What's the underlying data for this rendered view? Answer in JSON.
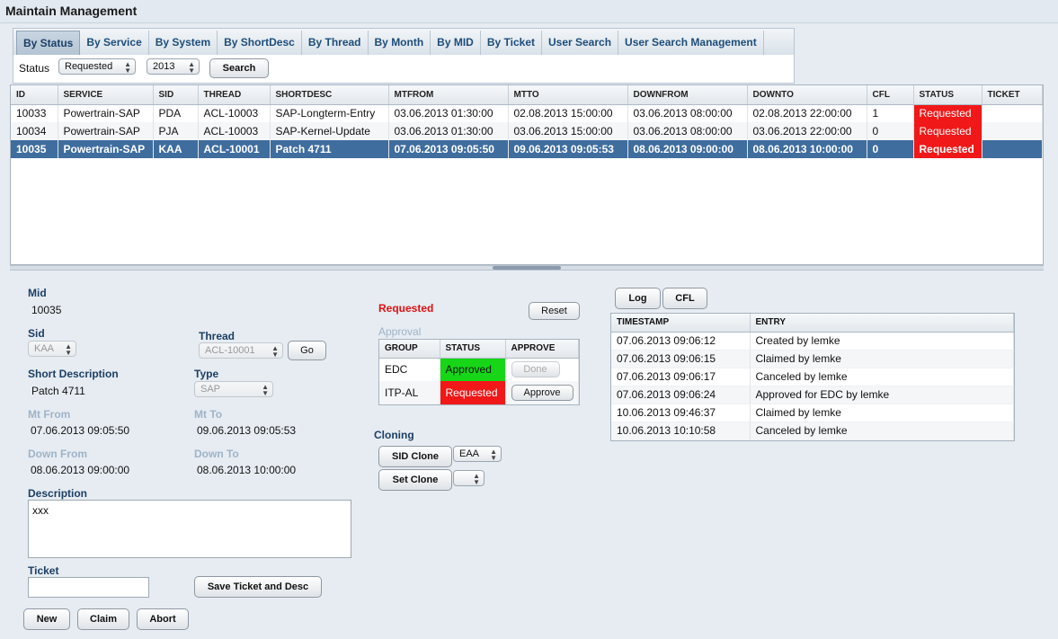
{
  "app": {
    "title": "Maintain Management"
  },
  "tabs": [
    "By Status",
    "By Service",
    "By System",
    "By ShortDesc",
    "By Thread",
    "By Month",
    "By MID",
    "By Ticket",
    "User Search",
    "User Search Management"
  ],
  "filter": {
    "status_label": "Status",
    "status_value": "Requested",
    "year_value": "2013",
    "search_label": "Search"
  },
  "grid": {
    "columns": [
      "ID",
      "SERVICE",
      "SID",
      "THREAD",
      "SHORTDESC",
      "MTFROM",
      "MTTO",
      "DOWNFROM",
      "DOWNTO",
      "CFL",
      "STATUS",
      "TICKET"
    ],
    "rows": [
      [
        "10033",
        "Powertrain-SAP",
        "PDA",
        "ACL-10003",
        "SAP-Longterm-Entry",
        "03.06.2013 01:30:00",
        "02.08.2013 15:00:00",
        "03.06.2013 08:00:00",
        "02.08.2013 22:00:00",
        "1",
        "Requested",
        ""
      ],
      [
        "10034",
        "Powertrain-SAP",
        "PJA",
        "ACL-10003",
        "SAP-Kernel-Update",
        "03.06.2013 01:30:00",
        "03.06.2013 15:00:00",
        "03.06.2013 08:00:00",
        "03.06.2013 22:00:00",
        "0",
        "Requested",
        ""
      ],
      [
        "10035",
        "Powertrain-SAP",
        "KAA",
        "ACL-10001",
        "Patch 4711",
        "07.06.2013 09:05:50",
        "09.06.2013 09:05:53",
        "08.06.2013 09:00:00",
        "08.06.2013 10:00:00",
        "0",
        "Requested",
        ""
      ]
    ]
  },
  "detail": {
    "mid_label": "Mid",
    "mid_value": "10035",
    "sid_label": "Sid",
    "sid_value": "KAA",
    "thread_label": "Thread",
    "thread_value": "ACL-10001",
    "go_label": "Go",
    "shortdesc_label": "Short Description",
    "shortdesc_value": "Patch 4711",
    "type_label": "Type",
    "type_value": "SAP",
    "mtfrom_label": "Mt From",
    "mtfrom_value": "07.06.2013 09:05:50",
    "mtto_label": "Mt To",
    "mtto_value": "09.06.2013 09:05:53",
    "downfrom_label": "Down From",
    "downfrom_value": "08.06.2013 09:00:00",
    "downto_label": "Down To",
    "downto_value": "08.06.2013 10:00:00",
    "description_label": "Description",
    "description_value": "xxx",
    "ticket_label": "Ticket",
    "ticket_value": "",
    "save_label": "Save Ticket and Desc",
    "new_label": "New",
    "claim_label": "Claim",
    "abort_label": "Abort"
  },
  "approval": {
    "status_text": "Requested",
    "reset_label": "Reset",
    "title": "Approval",
    "columns": [
      "GROUP",
      "STATUS",
      "APPROVE"
    ],
    "rows": [
      {
        "group": "EDC",
        "status": "Approved",
        "action": "Done"
      },
      {
        "group": "ITP-AL",
        "status": "Requested",
        "action": "Approve"
      }
    ]
  },
  "cloning": {
    "title": "Cloning",
    "sid_clone_label": "SID Clone",
    "sid_clone_value": "EAA",
    "set_clone_label": "Set Clone",
    "set_clone_value": ""
  },
  "log": {
    "log_label": "Log",
    "cfl_label": "CFL",
    "columns": [
      "TIMESTAMP",
      "ENTRY"
    ],
    "rows": [
      [
        "07.06.2013 09:06:12",
        "Created by lemke"
      ],
      [
        "07.06.2013 09:06:15",
        "Claimed by lemke"
      ],
      [
        "07.06.2013 09:06:17",
        "Canceled by lemke"
      ],
      [
        "07.06.2013 09:06:24",
        "Approved for EDC by lemke"
      ],
      [
        "10.06.2013 09:46:37",
        "Claimed by lemke"
      ],
      [
        "10.06.2013 10:10:58",
        "Canceled by lemke"
      ]
    ]
  }
}
